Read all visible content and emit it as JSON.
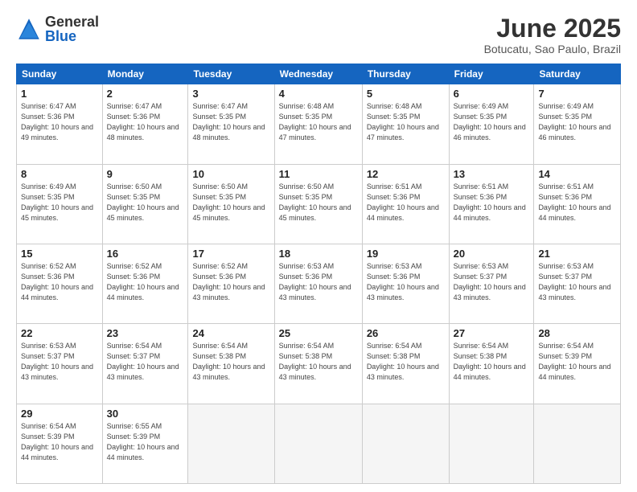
{
  "logo": {
    "general": "General",
    "blue": "Blue"
  },
  "title": "June 2025",
  "subtitle": "Botucatu, Sao Paulo, Brazil",
  "headers": [
    "Sunday",
    "Monday",
    "Tuesday",
    "Wednesday",
    "Thursday",
    "Friday",
    "Saturday"
  ],
  "weeks": [
    [
      {
        "day": "1",
        "sunrise": "Sunrise: 6:47 AM",
        "sunset": "Sunset: 5:36 PM",
        "daylight": "Daylight: 10 hours and 49 minutes."
      },
      {
        "day": "2",
        "sunrise": "Sunrise: 6:47 AM",
        "sunset": "Sunset: 5:36 PM",
        "daylight": "Daylight: 10 hours and 48 minutes."
      },
      {
        "day": "3",
        "sunrise": "Sunrise: 6:47 AM",
        "sunset": "Sunset: 5:35 PM",
        "daylight": "Daylight: 10 hours and 48 minutes."
      },
      {
        "day": "4",
        "sunrise": "Sunrise: 6:48 AM",
        "sunset": "Sunset: 5:35 PM",
        "daylight": "Daylight: 10 hours and 47 minutes."
      },
      {
        "day": "5",
        "sunrise": "Sunrise: 6:48 AM",
        "sunset": "Sunset: 5:35 PM",
        "daylight": "Daylight: 10 hours and 47 minutes."
      },
      {
        "day": "6",
        "sunrise": "Sunrise: 6:49 AM",
        "sunset": "Sunset: 5:35 PM",
        "daylight": "Daylight: 10 hours and 46 minutes."
      },
      {
        "day": "7",
        "sunrise": "Sunrise: 6:49 AM",
        "sunset": "Sunset: 5:35 PM",
        "daylight": "Daylight: 10 hours and 46 minutes."
      }
    ],
    [
      {
        "day": "8",
        "sunrise": "Sunrise: 6:49 AM",
        "sunset": "Sunset: 5:35 PM",
        "daylight": "Daylight: 10 hours and 45 minutes."
      },
      {
        "day": "9",
        "sunrise": "Sunrise: 6:50 AM",
        "sunset": "Sunset: 5:35 PM",
        "daylight": "Daylight: 10 hours and 45 minutes."
      },
      {
        "day": "10",
        "sunrise": "Sunrise: 6:50 AM",
        "sunset": "Sunset: 5:35 PM",
        "daylight": "Daylight: 10 hours and 45 minutes."
      },
      {
        "day": "11",
        "sunrise": "Sunrise: 6:50 AM",
        "sunset": "Sunset: 5:35 PM",
        "daylight": "Daylight: 10 hours and 45 minutes."
      },
      {
        "day": "12",
        "sunrise": "Sunrise: 6:51 AM",
        "sunset": "Sunset: 5:36 PM",
        "daylight": "Daylight: 10 hours and 44 minutes."
      },
      {
        "day": "13",
        "sunrise": "Sunrise: 6:51 AM",
        "sunset": "Sunset: 5:36 PM",
        "daylight": "Daylight: 10 hours and 44 minutes."
      },
      {
        "day": "14",
        "sunrise": "Sunrise: 6:51 AM",
        "sunset": "Sunset: 5:36 PM",
        "daylight": "Daylight: 10 hours and 44 minutes."
      }
    ],
    [
      {
        "day": "15",
        "sunrise": "Sunrise: 6:52 AM",
        "sunset": "Sunset: 5:36 PM",
        "daylight": "Daylight: 10 hours and 44 minutes."
      },
      {
        "day": "16",
        "sunrise": "Sunrise: 6:52 AM",
        "sunset": "Sunset: 5:36 PM",
        "daylight": "Daylight: 10 hours and 44 minutes."
      },
      {
        "day": "17",
        "sunrise": "Sunrise: 6:52 AM",
        "sunset": "Sunset: 5:36 PM",
        "daylight": "Daylight: 10 hours and 43 minutes."
      },
      {
        "day": "18",
        "sunrise": "Sunrise: 6:53 AM",
        "sunset": "Sunset: 5:36 PM",
        "daylight": "Daylight: 10 hours and 43 minutes."
      },
      {
        "day": "19",
        "sunrise": "Sunrise: 6:53 AM",
        "sunset": "Sunset: 5:36 PM",
        "daylight": "Daylight: 10 hours and 43 minutes."
      },
      {
        "day": "20",
        "sunrise": "Sunrise: 6:53 AM",
        "sunset": "Sunset: 5:37 PM",
        "daylight": "Daylight: 10 hours and 43 minutes."
      },
      {
        "day": "21",
        "sunrise": "Sunrise: 6:53 AM",
        "sunset": "Sunset: 5:37 PM",
        "daylight": "Daylight: 10 hours and 43 minutes."
      }
    ],
    [
      {
        "day": "22",
        "sunrise": "Sunrise: 6:53 AM",
        "sunset": "Sunset: 5:37 PM",
        "daylight": "Daylight: 10 hours and 43 minutes."
      },
      {
        "day": "23",
        "sunrise": "Sunrise: 6:54 AM",
        "sunset": "Sunset: 5:37 PM",
        "daylight": "Daylight: 10 hours and 43 minutes."
      },
      {
        "day": "24",
        "sunrise": "Sunrise: 6:54 AM",
        "sunset": "Sunset: 5:38 PM",
        "daylight": "Daylight: 10 hours and 43 minutes."
      },
      {
        "day": "25",
        "sunrise": "Sunrise: 6:54 AM",
        "sunset": "Sunset: 5:38 PM",
        "daylight": "Daylight: 10 hours and 43 minutes."
      },
      {
        "day": "26",
        "sunrise": "Sunrise: 6:54 AM",
        "sunset": "Sunset: 5:38 PM",
        "daylight": "Daylight: 10 hours and 43 minutes."
      },
      {
        "day": "27",
        "sunrise": "Sunrise: 6:54 AM",
        "sunset": "Sunset: 5:38 PM",
        "daylight": "Daylight: 10 hours and 44 minutes."
      },
      {
        "day": "28",
        "sunrise": "Sunrise: 6:54 AM",
        "sunset": "Sunset: 5:39 PM",
        "daylight": "Daylight: 10 hours and 44 minutes."
      }
    ],
    [
      {
        "day": "29",
        "sunrise": "Sunrise: 6:54 AM",
        "sunset": "Sunset: 5:39 PM",
        "daylight": "Daylight: 10 hours and 44 minutes."
      },
      {
        "day": "30",
        "sunrise": "Sunrise: 6:55 AM",
        "sunset": "Sunset: 5:39 PM",
        "daylight": "Daylight: 10 hours and 44 minutes."
      },
      null,
      null,
      null,
      null,
      null
    ]
  ]
}
